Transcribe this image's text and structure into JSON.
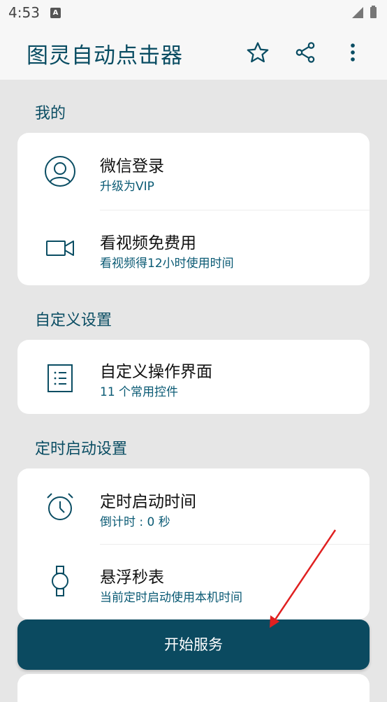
{
  "status_bar": {
    "time": "4:53",
    "notification_icon": "A"
  },
  "app_bar": {
    "title": "图灵自动点击器",
    "icons": [
      "star-icon",
      "share-icon",
      "more-vert-icon"
    ]
  },
  "sections": {
    "mine": {
      "title": "我的",
      "items": [
        {
          "title": "微信登录",
          "subtitle": "升级为VIP",
          "icon": "user-circle-icon"
        },
        {
          "title": "看视频免费用",
          "subtitle": "看视频得12小时使用时间",
          "icon": "video-camera-icon"
        }
      ]
    },
    "custom": {
      "title": "自定义设置",
      "items": [
        {
          "title": "自定义操作界面",
          "subtitle": "11 个常用控件",
          "icon": "list-icon"
        }
      ]
    },
    "timer": {
      "title": "定时启动设置",
      "items": [
        {
          "title": "定时启动时间",
          "subtitle": "倒计时 : 0 秒",
          "icon": "alarm-clock-icon"
        },
        {
          "title": "悬浮秒表",
          "subtitle": "当前定时启动使用本机时间",
          "icon": "stopwatch-icon"
        }
      ]
    }
  },
  "start_button": {
    "label": "开始服务"
  },
  "colors": {
    "accent": "#0a4d63",
    "button": "#0b4a60",
    "annotation": "#e02020"
  }
}
